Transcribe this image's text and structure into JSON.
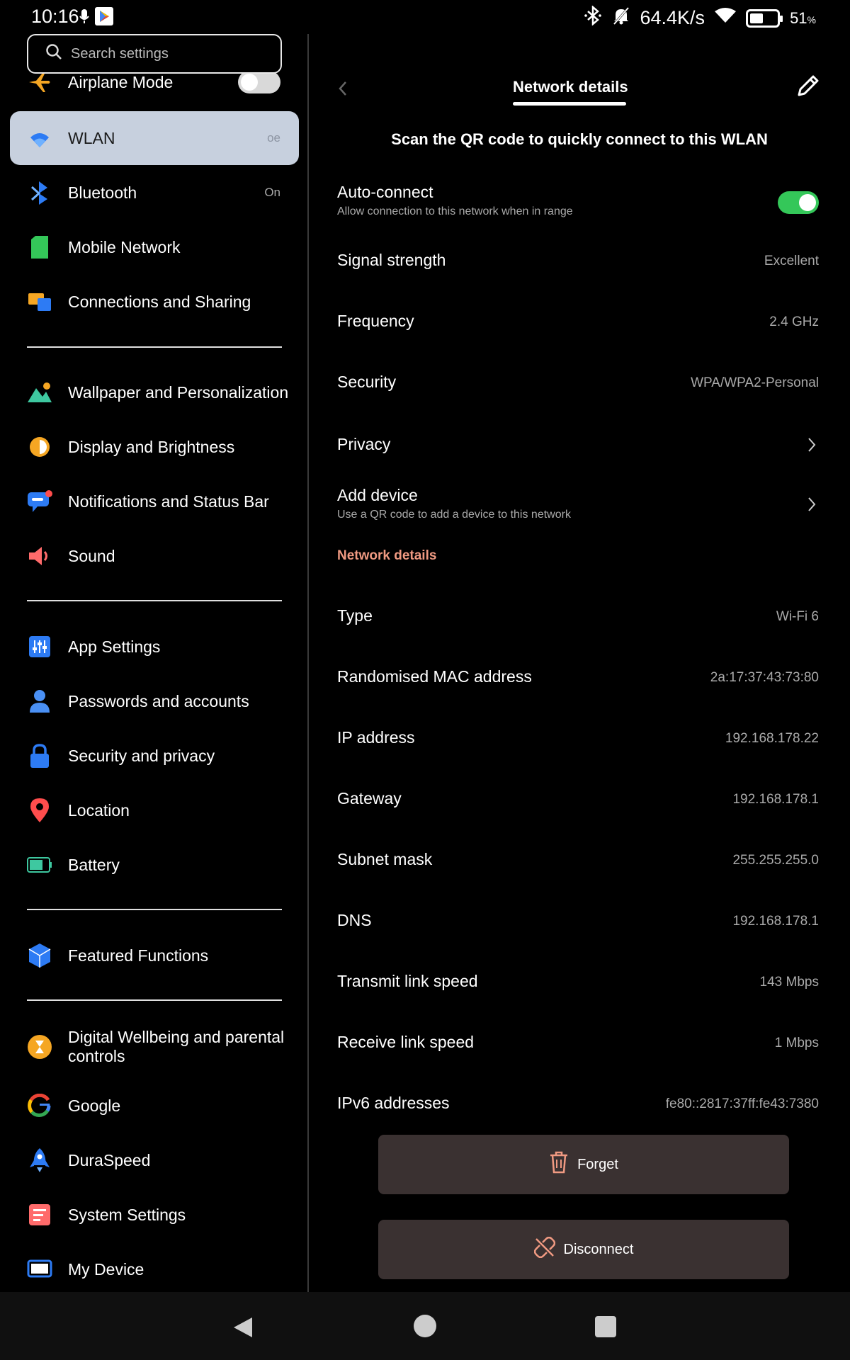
{
  "status_bar": {
    "time": "10:16",
    "speed": "64.4K/s",
    "battery_pct": "51",
    "battery_unit": "%",
    "battery_level": 0.51
  },
  "sidebar": {
    "search_placeholder": "Search settings",
    "items": [
      {
        "label": "Airplane Mode",
        "icon": "airplane-icon"
      },
      {
        "label": "WLAN",
        "value": "oe",
        "icon": "wifi-icon"
      },
      {
        "label": "Bluetooth",
        "value": "On",
        "icon": "bluetooth-icon"
      },
      {
        "label": "Mobile Network",
        "icon": "sim-card-icon"
      },
      {
        "label": "Connections and Sharing",
        "icon": "connections-icon"
      },
      {
        "label": "Wallpaper and Personalization",
        "icon": "wallpaper-icon"
      },
      {
        "label": "Display and Brightness",
        "icon": "brightness-icon"
      },
      {
        "label": "Notifications and Status Bar",
        "icon": "notifications-icon"
      },
      {
        "label": "Sound",
        "icon": "speaker-icon"
      },
      {
        "label": "App Settings",
        "icon": "app-settings-icon"
      },
      {
        "label": "Passwords and accounts",
        "icon": "person-icon"
      },
      {
        "label": "Security and privacy",
        "icon": "lock-icon"
      },
      {
        "label": "Location",
        "icon": "location-pin-icon"
      },
      {
        "label": "Battery",
        "icon": "battery-icon"
      },
      {
        "label": "Featured Functions",
        "icon": "cube-icon"
      },
      {
        "label": "Digital Wellbeing and parental controls",
        "icon": "hourglass-icon"
      },
      {
        "label": "Google",
        "icon": "google-icon"
      },
      {
        "label": "DuraSpeed",
        "icon": "rocket-icon"
      },
      {
        "label": "System Settings",
        "icon": "system-settings-icon"
      },
      {
        "label": "My Device",
        "icon": "device-icon"
      }
    ]
  },
  "detail": {
    "title": "Network details",
    "qr_text": "Scan the QR code to quickly connect to this WLAN",
    "auto_connect": {
      "label": "Auto-connect",
      "sub": "Allow connection to this network when in range",
      "enabled": true
    },
    "signal": {
      "label": "Signal strength",
      "value": "Excellent"
    },
    "frequency": {
      "label": "Frequency",
      "value": "2.4 GHz"
    },
    "security": {
      "label": "Security",
      "value": "WPA/WPA2-Personal"
    },
    "privacy": {
      "label": "Privacy"
    },
    "add_device": {
      "label": "Add device",
      "sub": "Use a QR code to add a device to this network"
    },
    "section_title": "Network details",
    "type": {
      "label": "Type",
      "value": "Wi-Fi 6"
    },
    "mac": {
      "label": "Randomised MAC address",
      "value": "2a:17:37:43:73:80"
    },
    "ip": {
      "label": "IP address",
      "value": "192.168.178.22"
    },
    "gateway": {
      "label": "Gateway",
      "value": "192.168.178.1"
    },
    "subnet": {
      "label": "Subnet mask",
      "value": "255.255.255.0"
    },
    "dns": {
      "label": "DNS",
      "value": "192.168.178.1"
    },
    "tx_speed": {
      "label": "Transmit link speed",
      "value": "143 Mbps"
    },
    "rx_speed": {
      "label": "Receive link speed",
      "value": "1 Mbps"
    },
    "ipv6": {
      "label": "IPv6 addresses",
      "value": "fe80::2817:37ff:fe43:7380"
    },
    "forget_label": "Forget",
    "disconnect_label": "Disconnect"
  },
  "colors": {
    "accent": "#f09a82",
    "toggle_on": "#34c759",
    "active_item": "#c7d0de"
  }
}
